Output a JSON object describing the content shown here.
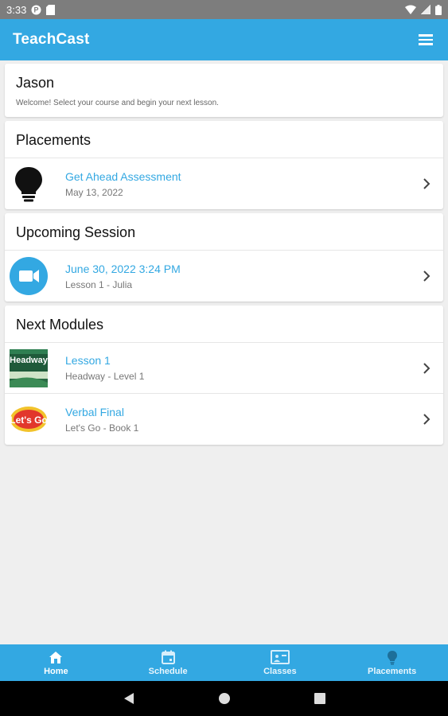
{
  "status_bar": {
    "time": "3:33"
  },
  "app_bar": {
    "title": "TeachCast",
    "color": "#33a8e2"
  },
  "welcome": {
    "name": "Jason",
    "subtitle": "Welcome! Select your course and begin your next lesson."
  },
  "placements": {
    "title": "Placements",
    "items": [
      {
        "primary": "Get Ahead Assessment",
        "secondary": "May 13, 2022",
        "icon": "lightbulb-icon"
      }
    ]
  },
  "upcoming": {
    "title": "Upcoming Session",
    "items": [
      {
        "primary": "June 30, 2022 3:24 PM",
        "secondary": "Lesson 1 - Julia",
        "icon": "video-camera-icon"
      }
    ]
  },
  "next_modules": {
    "title": "Next Modules",
    "items": [
      {
        "primary": "Lesson 1",
        "secondary": "Headway - Level 1",
        "icon": "headway-book-cover",
        "cover_text": "Headway"
      },
      {
        "primary": "Verbal Final",
        "secondary": "Let's Go - Book 1",
        "icon": "lets-go-logo",
        "cover_text": "Let's Go"
      }
    ]
  },
  "bottom_nav": {
    "items": [
      {
        "label": "Home",
        "icon": "home-icon",
        "active": true
      },
      {
        "label": "Schedule",
        "icon": "calendar-icon",
        "active": false
      },
      {
        "label": "Classes",
        "icon": "classroom-icon",
        "active": false
      },
      {
        "label": "Placements",
        "icon": "lightbulb-icon",
        "active": false
      }
    ]
  }
}
